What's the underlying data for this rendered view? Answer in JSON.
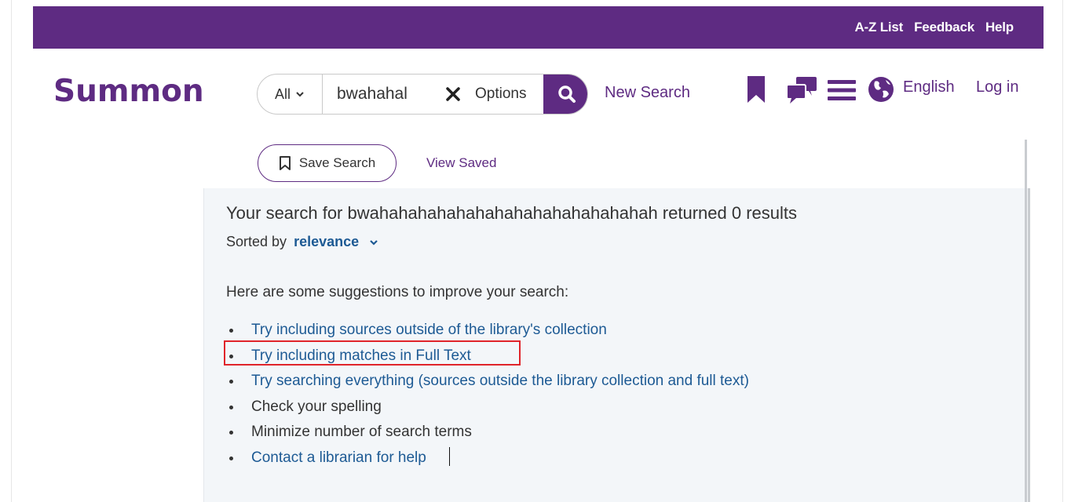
{
  "topbar": {
    "links": [
      "A-Z List",
      "Feedback",
      "Help"
    ],
    "background": "#5e2b82"
  },
  "header": {
    "logo": "Summon",
    "search": {
      "scope": "All",
      "query": "bwahahal",
      "options_label": "Options"
    },
    "new_search": "New Search",
    "language": "English",
    "login": "Log in"
  },
  "toolbar": {
    "save_search": "Save Search",
    "view_saved": "View Saved"
  },
  "results": {
    "summary": "Your search for bwahahahahahahahahahahahahahahah returned 0 results",
    "sorted_label": "Sorted by",
    "sorted_value": "relevance",
    "suggestions_intro": "Here are some suggestions to improve your search:",
    "suggestions": [
      {
        "text": "Try including sources outside of the library's collection",
        "link": true
      },
      {
        "text": "Try including matches in Full Text",
        "link": true
      },
      {
        "text": "Try searching everything (sources outside the library collection and full text)",
        "link": true
      },
      {
        "text": "Check your spelling",
        "link": false
      },
      {
        "text": "Minimize number of search terms",
        "link": false
      },
      {
        "text": "Contact a librarian for help",
        "link": true
      }
    ]
  },
  "colors": {
    "brand": "#5e2b82",
    "link": "#1d5a94",
    "highlight": "#e0242a"
  }
}
